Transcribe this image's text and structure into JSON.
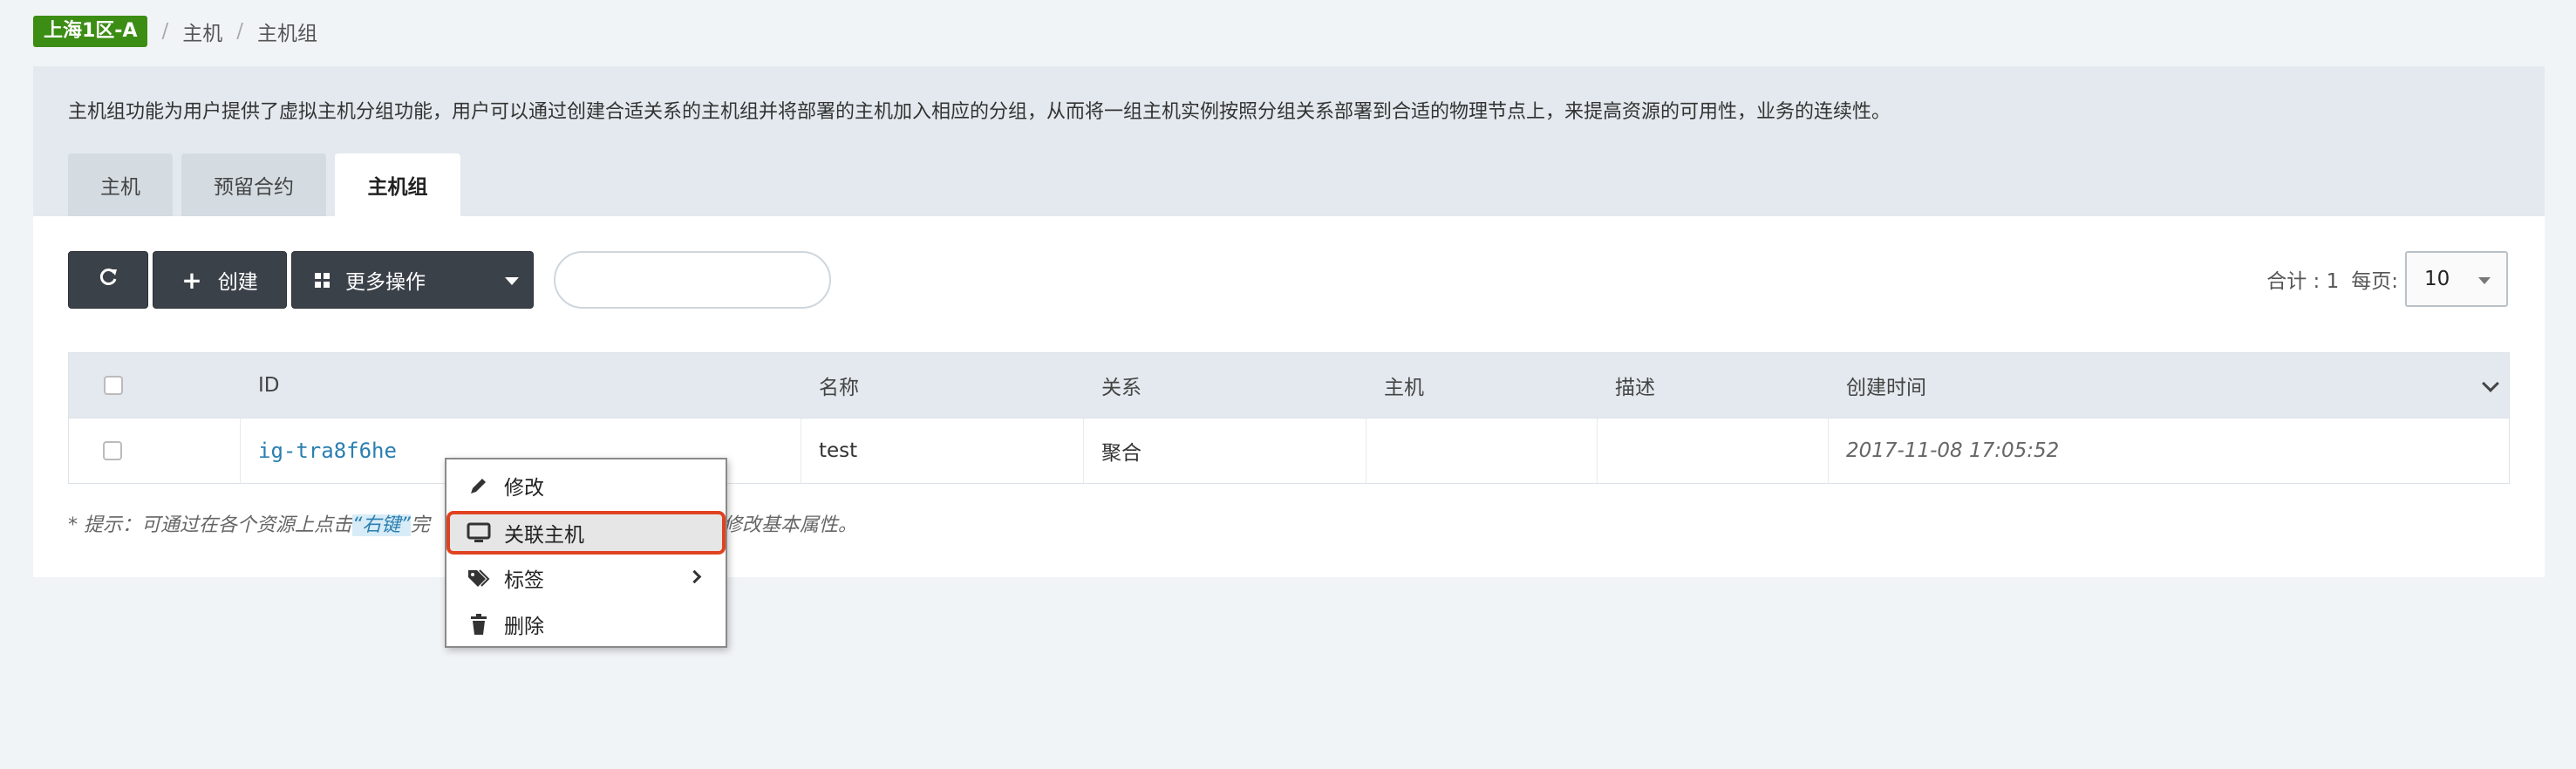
{
  "breadcrumb": {
    "zone": "上海1区-A",
    "sep1": "/",
    "item1": "主机",
    "sep2": "/",
    "item2": "主机组"
  },
  "intro": "主机组功能为用户提供了虚拟主机分组功能，用户可以通过创建合适关系的主机组并将部署的主机加入相应的分组，从而将一组主机实例按照分组关系部署到合适的物理节点上，来提高资源的可用性，业务的连续性。",
  "tabs": [
    {
      "label": "主机",
      "active": false
    },
    {
      "label": "预留合约",
      "active": false
    },
    {
      "label": "主机组",
      "active": true
    }
  ],
  "toolbar": {
    "refresh_icon": "refresh-icon",
    "create_label": "创建",
    "more_label": "更多操作",
    "search_placeholder": ""
  },
  "pager": {
    "total_label": "合计 : 1",
    "per_page_label": "每页:",
    "page_size": "10"
  },
  "table": {
    "columns": [
      "ID",
      "名称",
      "关系",
      "主机",
      "描述",
      "创建时间"
    ],
    "rows": [
      {
        "id": "ig-tra8f6he",
        "name": "test",
        "relation": "聚合",
        "hosts": "",
        "description": "",
        "created": "2017-11-08 17:05:52"
      }
    ]
  },
  "hint": {
    "prefix": "* 提示：可通过在各个资源上点击",
    "highlight": "“右键”",
    "mid": "完",
    "suffix": "修改基本属性。"
  },
  "context_menu": {
    "items": [
      {
        "label": "修改",
        "icon": "pencil-icon"
      },
      {
        "label": "关联主机",
        "icon": "monitor-icon",
        "highlighted": true
      },
      {
        "label": "标签",
        "icon": "tags-icon",
        "has_submenu": true
      },
      {
        "label": "删除",
        "icon": "trash-icon"
      }
    ]
  },
  "colors": {
    "zone_badge": "#3c8d14",
    "link": "#2a7fb0",
    "button_dark": "#3b4149",
    "highlight_border": "#e0421f"
  }
}
